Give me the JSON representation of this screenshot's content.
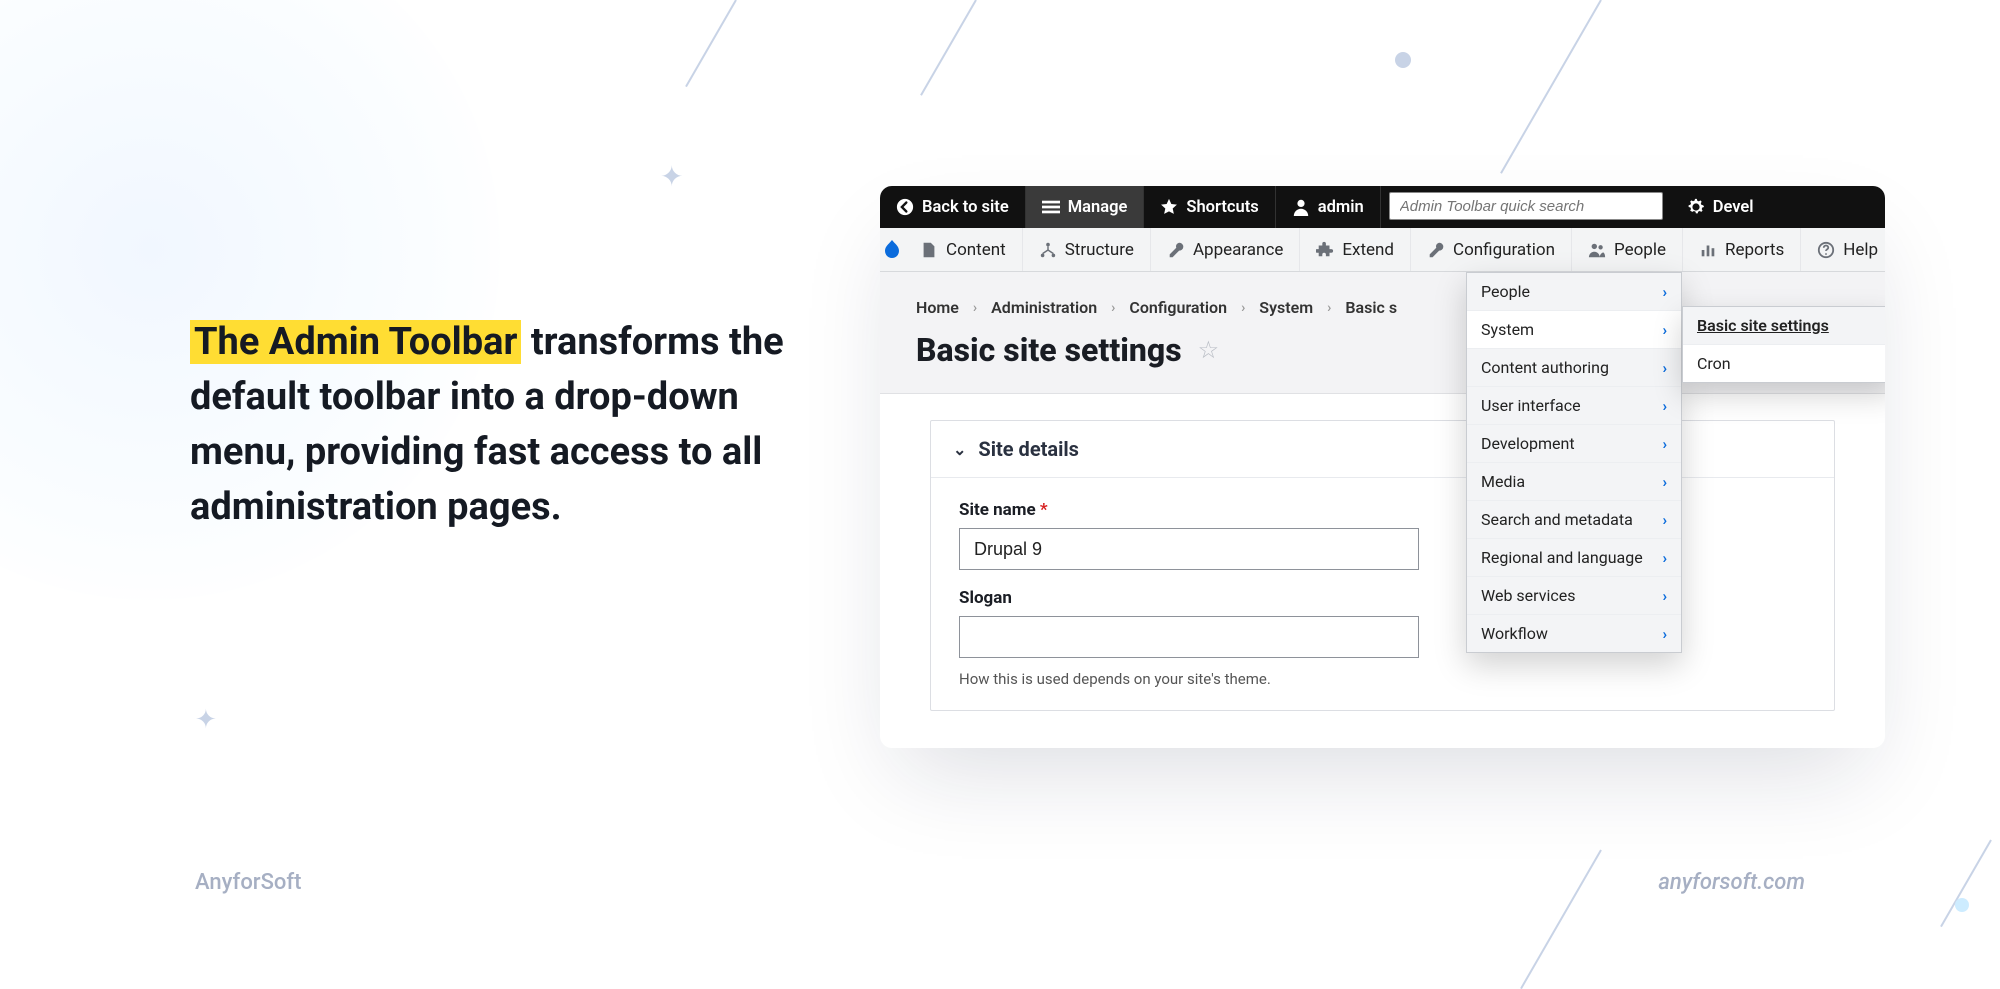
{
  "marketing": {
    "highlight": "The Admin Toolbar",
    "rest": " transforms the default toolbar into a drop-down menu, providing fast access to all administration pages."
  },
  "footer": {
    "left": "AnyforSoft",
    "right": "anyforsoft.com"
  },
  "toolbar": {
    "back": "Back to site",
    "manage": "Manage",
    "shortcuts": "Shortcuts",
    "user": "admin",
    "search_placeholder": "Admin Toolbar quick search",
    "devel": "Devel"
  },
  "menubar": {
    "content": "Content",
    "structure": "Structure",
    "appearance": "Appearance",
    "extend": "Extend",
    "configuration": "Configuration",
    "people": "People",
    "reports": "Reports",
    "help": "Help"
  },
  "breadcrumbs": [
    "Home",
    "Administration",
    "Configuration",
    "System",
    "Basic s"
  ],
  "page_title": "Basic site settings",
  "config_submenu": [
    "People",
    "System",
    "Content authoring",
    "User interface",
    "Development",
    "Media",
    "Search and metadata",
    "Regional and language",
    "Web services",
    "Workflow"
  ],
  "system_submenu": [
    "Basic site settings",
    "Cron"
  ],
  "form": {
    "section_title": "Site details",
    "site_name_label": "Site name",
    "site_name_value": "Drupal 9",
    "slogan_label": "Slogan",
    "slogan_value": "",
    "slogan_hint": "How this is used depends on your site's theme."
  }
}
